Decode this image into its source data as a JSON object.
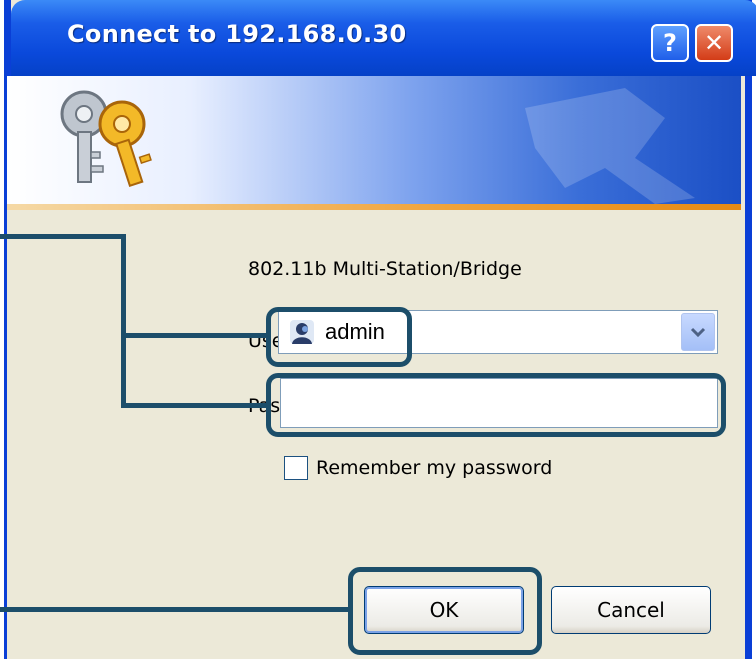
{
  "window": {
    "title": "Connect to 192.168.0.30",
    "help_label": "?",
    "close_label": "✕"
  },
  "banner": {
    "icon": "keys-icon"
  },
  "form": {
    "server_text": "802.11b Multi-Station/Bridge",
    "user_label": "User name:",
    "user_value": "admin",
    "password_label": "Password:",
    "password_value": "",
    "remember_label": "Remember my password",
    "remember_checked": false
  },
  "buttons": {
    "ok_label": "OK",
    "cancel_label": "Cancel"
  },
  "colors": {
    "callout": "#1c4e6a",
    "titlebar": "#0a49db",
    "dialog_bg": "#ece9d8"
  }
}
